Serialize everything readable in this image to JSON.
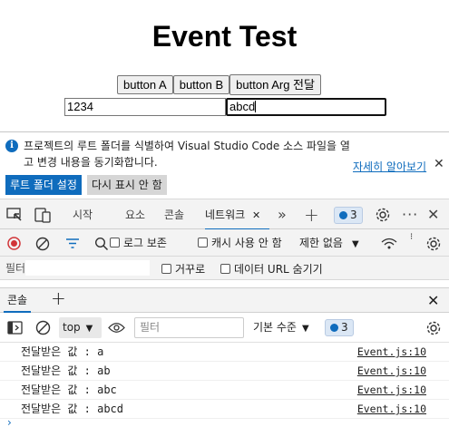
{
  "page": {
    "title": "Event Test",
    "buttons": [
      "button A",
      "button B",
      "button Arg 전달"
    ],
    "input_a_value": "1234",
    "input_b_value": "abcd"
  },
  "infobar": {
    "message": "프로젝트의 루트 폴더를 식별하여 Visual Studio Code 소스 파일을 열고 변경 내용을 동기화합니다.",
    "learn_more": "자세히 알아보기",
    "primary_button": "루트 폴더 설정",
    "secondary_button": "다시 표시 안 함"
  },
  "tabs": {
    "items": [
      "시작",
      "요소",
      "콘솔",
      "네트워크"
    ],
    "active": "네트워크",
    "issues_count": "3"
  },
  "network_toolbar": {
    "preserve_log": "로그 보존",
    "disable_cache": "캐시 사용 안 함",
    "throttling": "제한 없음"
  },
  "filter_bar": {
    "filter_label": "필터",
    "invert": "거꾸로",
    "hide_data_urls": "데이터 URL 숨기기"
  },
  "drawer": {
    "tab": "콘솔"
  },
  "console_toolbar": {
    "context": "top",
    "filter_placeholder": "필터",
    "level": "기본 수준",
    "issues_count": "3"
  },
  "console_logs": [
    {
      "message": "전달받은 값 : a",
      "source": "Event.js:10"
    },
    {
      "message": "전달받은 값 : ab",
      "source": "Event.js:10"
    },
    {
      "message": "전달받은 값 : abc",
      "source": "Event.js:10"
    },
    {
      "message": "전달받은 값 : abcd",
      "source": "Event.js:10"
    }
  ],
  "colors": {
    "accent": "#0f6cbd",
    "record_red": "#d13438"
  }
}
